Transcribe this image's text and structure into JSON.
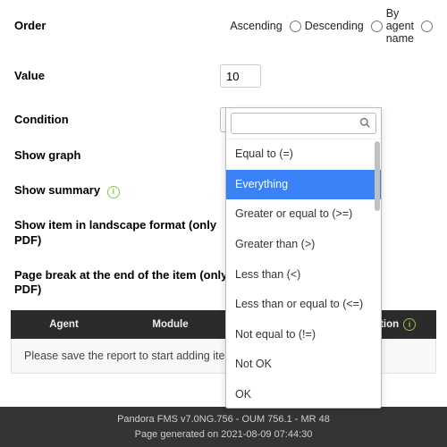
{
  "labels": {
    "order": "Order",
    "value": "Value",
    "condition": "Condition",
    "show_graph": "Show graph",
    "show_summary": "Show summary",
    "landscape": "Show item in landscape format (only PDF)",
    "page_break": "Page break at the end of the item (only PDF)"
  },
  "order": {
    "ascending": "Ascending",
    "descending": "Descending",
    "by_agent": "By agent name"
  },
  "value_input": "10",
  "condition_selected": "Everything",
  "condition_options": [
    "Equal to (=)",
    "Everything",
    "Greater or equal to (>=)",
    "Greater than (>)",
    "Less than (<)",
    "Less than or equal to (<=)",
    "Not equal to (!=)",
    "Not OK",
    "OK"
  ],
  "table": {
    "agent": "Agent",
    "module": "Module",
    "operation": "Operation",
    "empty": "Please save the report to start adding items into the list."
  },
  "footer": {
    "line1": "Pandora FMS v7.0NG.756 - OUM 756.1 - MR 48",
    "line2": "Page generated on 2021-08-09 07:44:30"
  }
}
